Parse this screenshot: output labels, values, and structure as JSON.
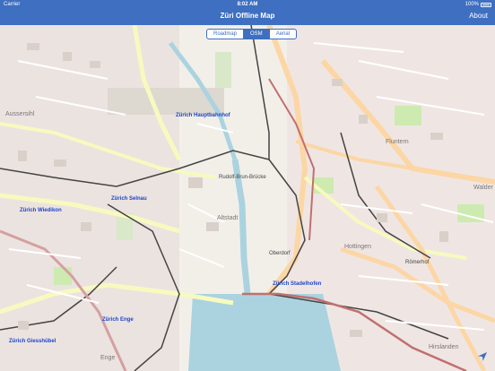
{
  "status_bar": {
    "carrier": "Carrier",
    "time": "8:02 AM",
    "battery": "100%"
  },
  "nav": {
    "title": "Züri Offline Map",
    "about_label": "About"
  },
  "map_modes": {
    "options": [
      "Roadmap",
      "OSM",
      "Aerial"
    ],
    "selected": "OSM"
  },
  "map_labels": {
    "hauptbahnhof": "Zürich Hauptbahnhof",
    "selnau": "Zürich Selnau",
    "wiedikon": "Zürich Wiedikon",
    "stadelhofen": "Zürich Stadelhofen",
    "enge": "Zürich Enge",
    "giesshuebel": "Zürich Giesshübel",
    "fluntern": "Fluntern",
    "hottingen": "Hottingen",
    "hirslanden": "Hirslanden",
    "altstadt": "Altstadt",
    "ausserihl": "Aussersihl",
    "enge_area": "Enge",
    "walder": "Walder",
    "roemerhof": "Römerhof",
    "oberdorf": "Oberdorf",
    "rudolf_brun": "Rudolf-Brun-Brücke"
  },
  "colors": {
    "accent": "#3e6fc1",
    "map_bg": "#f2efe9",
    "lake": "#aad3df"
  }
}
